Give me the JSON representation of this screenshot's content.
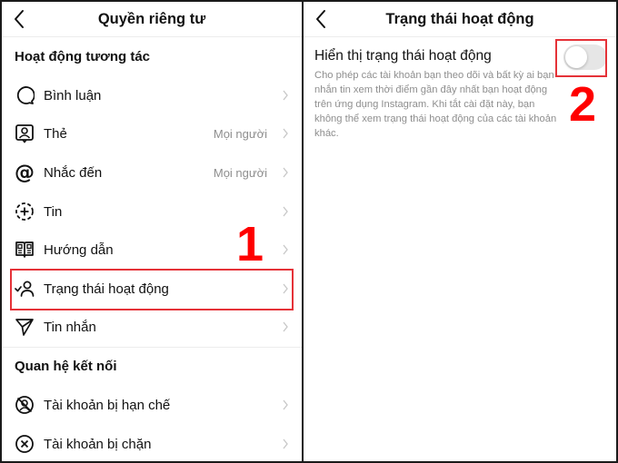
{
  "left_screen": {
    "header": {
      "title": "Quyền riêng tư",
      "back_icon": "chevron-left-icon"
    },
    "sections": [
      {
        "title": "Hoạt động tương tác",
        "items": [
          {
            "label": "Bình luận",
            "value": "",
            "icon": "comment-icon"
          },
          {
            "label": "Thẻ",
            "value": "Mọi người",
            "icon": "tag-person-icon"
          },
          {
            "label": "Nhắc đến",
            "value": "Mọi người",
            "icon": "at-mention-icon"
          },
          {
            "label": "Tin",
            "value": "",
            "icon": "story-add-icon"
          },
          {
            "label": "Hướng dẫn",
            "value": "",
            "icon": "guide-book-icon"
          },
          {
            "label": "Trạng thái hoạt động",
            "value": "",
            "icon": "person-check-icon"
          },
          {
            "label": "Tin nhắn",
            "value": "",
            "icon": "send-icon"
          }
        ]
      },
      {
        "title": "Quan hệ kết nối",
        "items": [
          {
            "label": "Tài khoản bị hạn chế",
            "value": "",
            "icon": "restricted-account-icon"
          },
          {
            "label": "Tài khoản bị chặn",
            "value": "",
            "icon": "blocked-account-icon"
          }
        ]
      }
    ],
    "annotation": "1"
  },
  "right_screen": {
    "header": {
      "title": "Trạng thái hoạt động",
      "back_icon": "chevron-left-icon"
    },
    "setting": {
      "title": "Hiển thị trạng thái hoạt động",
      "description": "Cho phép các tài khoản bạn theo dõi và bất kỳ ai bạn nhắn tin xem thời điểm gần đây nhất bạn hoạt động trên ứng dụng Instagram. Khi tắt cài đặt này, bạn không thể xem trạng thái hoạt động của các tài khoản khác.",
      "enabled": false
    },
    "annotation": "2"
  },
  "colors": {
    "highlight": "#e53238",
    "annotation": "#ff0000",
    "secondary_text": "#8e8e8e",
    "toggle_off": "#e6e6e6"
  }
}
